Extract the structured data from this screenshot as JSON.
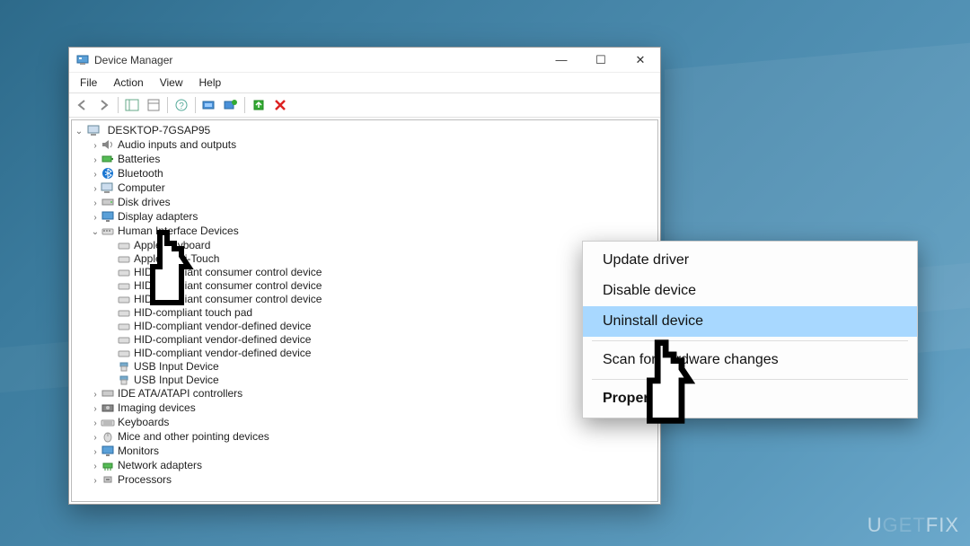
{
  "window": {
    "title": "Device Manager",
    "controls": {
      "min": "—",
      "max": "☐",
      "close": "✕"
    }
  },
  "menu": {
    "file": "File",
    "action": "Action",
    "view": "View",
    "help": "Help"
  },
  "toolbar": {
    "back": "⇦",
    "fwd": "⇨"
  },
  "root": "DESKTOP-7GSAP95",
  "categories": [
    {
      "label": "Audio inputs and outputs",
      "icon": "audio",
      "expand": ">"
    },
    {
      "label": "Batteries",
      "icon": "battery",
      "expand": ">"
    },
    {
      "label": "Bluetooth",
      "icon": "bluetooth",
      "expand": ">"
    },
    {
      "label": "Computer",
      "icon": "computer",
      "expand": ">"
    },
    {
      "label": "Disk drives",
      "icon": "disk",
      "expand": ">"
    },
    {
      "label": "Display adapters",
      "icon": "display",
      "expand": ">"
    }
  ],
  "hid": {
    "label": "Human Interface Devices",
    "expand": "v",
    "children": [
      "Apple Keyboard",
      "Apple Multi-Touch",
      "HID-compliant consumer control device",
      "HID-compliant consumer control device",
      "HID-compliant consumer control device",
      "HID-compliant touch pad",
      "HID-compliant vendor-defined device",
      "HID-compliant vendor-defined device",
      "HID-compliant vendor-defined device",
      "USB Input Device",
      "USB Input Device"
    ]
  },
  "categories2": [
    {
      "label": "IDE ATA/ATAPI controllers",
      "icon": "ide"
    },
    {
      "label": "Imaging devices",
      "icon": "imaging"
    },
    {
      "label": "Keyboards",
      "icon": "keyboard"
    },
    {
      "label": "Mice and other pointing devices",
      "icon": "mouse"
    },
    {
      "label": "Monitors",
      "icon": "monitor"
    },
    {
      "label": "Network adapters",
      "icon": "network"
    },
    {
      "label": "Processors",
      "icon": "cpu"
    }
  ],
  "ctx": {
    "update": "Update driver",
    "disable": "Disable device",
    "uninstall": "Uninstall device",
    "scan": "Scan for hardware changes",
    "properties": "Properties"
  },
  "watermark": {
    "a": "U",
    "b": "GET",
    "c": "FIX"
  }
}
